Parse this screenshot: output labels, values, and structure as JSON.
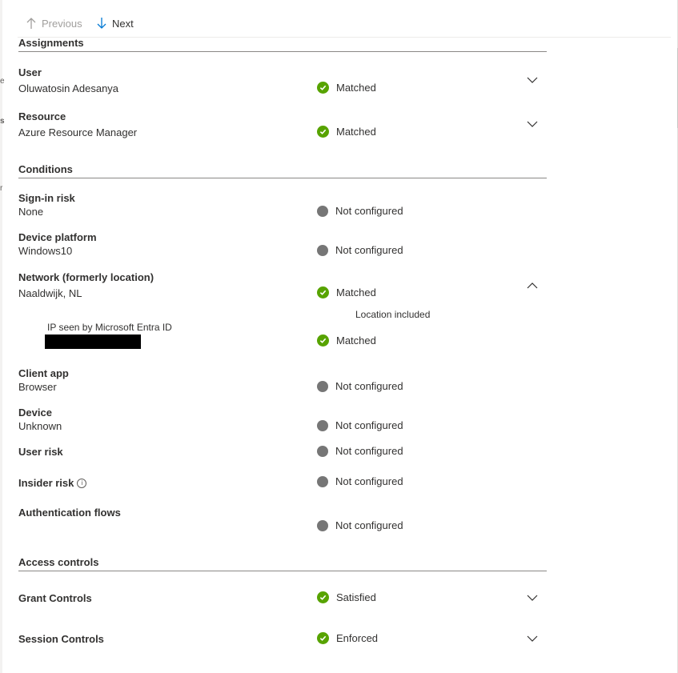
{
  "nav": {
    "previous_label": "Previous",
    "next_label": "Next"
  },
  "sections": {
    "assignments": "Assignments",
    "conditions": "Conditions",
    "access_controls": "Access controls"
  },
  "assignments": {
    "user": {
      "label": "User",
      "value": "Oluwatosin Adesanya",
      "status": "Matched"
    },
    "resource": {
      "label": "Resource",
      "value": "Azure Resource Manager",
      "status": "Matched"
    }
  },
  "conditions": {
    "sign_in_risk": {
      "label": "Sign-in risk",
      "value": "None",
      "status": "Not configured"
    },
    "device_platform": {
      "label": "Device platform",
      "value": "Windows10",
      "status": "Not configured"
    },
    "network": {
      "label": "Network (formerly location)",
      "value": "Naaldwijk, NL",
      "status": "Matched",
      "detail": "Location included",
      "ip_label": "IP seen by Microsoft Entra ID",
      "ip_status": "Matched"
    },
    "client_app": {
      "label": "Client app",
      "value": "Browser",
      "status": "Not configured"
    },
    "device": {
      "label": "Device",
      "value": "Unknown",
      "status": "Not configured"
    },
    "user_risk": {
      "label": "User risk",
      "status": "Not configured"
    },
    "insider_risk": {
      "label": "Insider risk",
      "status": "Not configured"
    },
    "auth_flows": {
      "label": "Authentication flows",
      "status": "Not configured"
    }
  },
  "access_controls": {
    "grant": {
      "label": "Grant Controls",
      "status": "Satisfied"
    },
    "session": {
      "label": "Session Controls",
      "status": "Enforced"
    }
  },
  "colors": {
    "matched": "#57a300",
    "not_configured": "#767676",
    "accent": "#0078d4"
  },
  "icons": {
    "previous": "arrow-up-icon",
    "next": "arrow-down-icon",
    "matched": "check-circle-icon",
    "not_configured": "gray-circle-icon",
    "expand": "chevron-down-icon",
    "collapse": "chevron-up-icon",
    "info": "info-icon"
  }
}
